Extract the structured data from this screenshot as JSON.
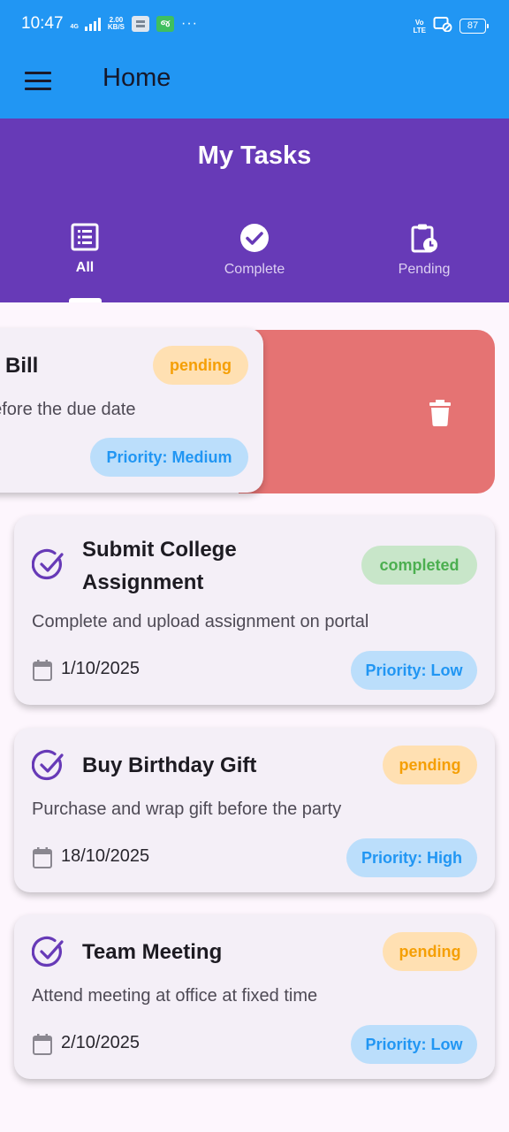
{
  "status_bar": {
    "time": "10:47",
    "network_type": "4G",
    "data_speed_value": "2.00",
    "data_speed_unit": "KB/S",
    "notification_app_label": "જ",
    "more_indicator": "···",
    "volte_line1": "Vo",
    "volte_line2": "LTE",
    "battery": "87"
  },
  "app_bar": {
    "title": "Home",
    "menu_icon": "menu-icon"
  },
  "header": {
    "title": "My Tasks",
    "tabs": [
      {
        "label": "All",
        "icon": "list-icon",
        "active": true
      },
      {
        "label": "Complete",
        "icon": "check-circle-icon",
        "active": false
      },
      {
        "label": "Pending",
        "icon": "clipboard-clock-icon",
        "active": false
      }
    ]
  },
  "tasks": [
    {
      "title": "y Bill",
      "description": "before the due date",
      "status": "pending",
      "priority": "Priority: Medium",
      "date": "",
      "swiped": true
    },
    {
      "title_line1": "Submit College",
      "title_line2": "Assignment",
      "description": "Complete and upload assignment on portal",
      "status": "completed",
      "priority": "Priority: Low",
      "date": "1/10/2025"
    },
    {
      "title": "Buy Birthday Gift",
      "description": "Purchase and wrap gift before the party",
      "status": "pending",
      "priority": "Priority: High",
      "date": "18/10/2025"
    },
    {
      "title": "Team Meeting",
      "description": "Attend meeting at office at fixed time",
      "status": "pending",
      "priority": "Priority: Low",
      "date": "2/10/2025"
    }
  ],
  "colors": {
    "app_bar": "#2196f3",
    "header": "#673ab7",
    "delete_background": "#e57373",
    "pending_badge": "#ffe0b2",
    "pending_text": "#f59f05",
    "completed_badge": "#c8e6c9",
    "completed_text": "#4caf50",
    "priority_badge": "#bbdefb",
    "priority_text": "#2196f3",
    "check_icon": "#673ab7"
  }
}
